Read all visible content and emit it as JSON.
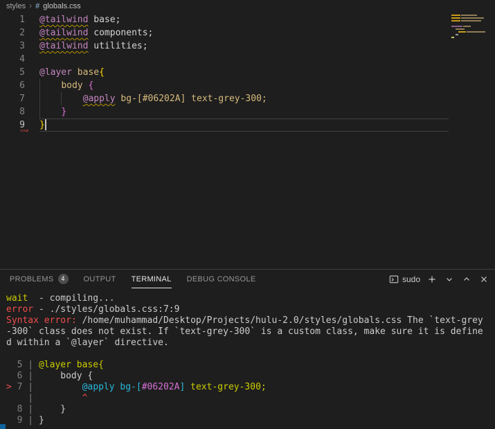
{
  "colors": {
    "background": "#1e1e1e",
    "accent_blue": "#0e639c",
    "error_red": "#f14c4c",
    "warning_yellow": "#cdcd00",
    "syntax_atrule": "#c586c0",
    "syntax_selector": "#d7ba7d",
    "syntax_plain": "#d4d4d4",
    "bracket_gold": "#ffd700",
    "bracket_purple": "#da70d6",
    "terminal_cyan": "#29b8db",
    "terminal_magenta": "#d670d6"
  },
  "breadcrumb": {
    "folder": "styles",
    "separator": "›",
    "file_symbol": "#",
    "file": "globals.css"
  },
  "editor": {
    "lines": [
      {
        "num": "1",
        "segs": [
          {
            "t": "@tailwind",
            "c": "atrule squiggle"
          },
          {
            "t": " base;",
            "c": "plain"
          }
        ]
      },
      {
        "num": "2",
        "segs": [
          {
            "t": "@tailwind",
            "c": "atrule squiggle"
          },
          {
            "t": " components;",
            "c": "plain"
          }
        ]
      },
      {
        "num": "3",
        "segs": [
          {
            "t": "@tailwind",
            "c": "atrule squiggle"
          },
          {
            "t": " utilities;",
            "c": "plain"
          }
        ]
      },
      {
        "num": "4",
        "segs": []
      },
      {
        "num": "5",
        "segs": [
          {
            "t": "@layer",
            "c": "atrule"
          },
          {
            "t": " ",
            "c": "plain"
          },
          {
            "t": "base",
            "c": "selector"
          },
          {
            "t": "{",
            "c": "brace1"
          }
        ]
      },
      {
        "num": "6",
        "segs": [
          {
            "t": "    ",
            "c": "plain"
          },
          {
            "t": "body",
            "c": "selector"
          },
          {
            "t": " ",
            "c": "plain"
          },
          {
            "t": "{",
            "c": "brace2"
          }
        ]
      },
      {
        "num": "7",
        "segs": [
          {
            "t": "        ",
            "c": "plain"
          },
          {
            "t": "@apply",
            "c": "atrule squiggle"
          },
          {
            "t": " ",
            "c": "plain"
          },
          {
            "t": "bg-[#06202A] text-grey-300;",
            "c": "selector"
          }
        ]
      },
      {
        "num": "8",
        "segs": [
          {
            "t": "    ",
            "c": "plain"
          },
          {
            "t": "}",
            "c": "brace2"
          }
        ]
      },
      {
        "num": "9",
        "segs": [
          {
            "t": "}",
            "c": "brace1"
          }
        ],
        "current": true,
        "cursor": true,
        "error_mark": true
      }
    ]
  },
  "panel": {
    "tabs": [
      {
        "label": "PROBLEMS",
        "badge": "4",
        "active": false
      },
      {
        "label": "OUTPUT",
        "active": false
      },
      {
        "label": "TERMINAL",
        "active": true
      },
      {
        "label": "DEBUG CONSOLE",
        "active": false
      }
    ],
    "terminal_profile": "sudo",
    "action_icons": [
      "terminal-icon",
      "new-terminal-icon",
      "chevron-down-icon",
      "chevron-up-icon",
      "close-icon"
    ]
  },
  "terminal": {
    "lines": [
      {
        "segs": [
          {
            "t": "wait",
            "c": "yellow"
          },
          {
            "t": "  - compiling...",
            "c": "plain"
          }
        ]
      },
      {
        "segs": [
          {
            "t": "error",
            "c": "red"
          },
          {
            "t": " - ./styles/globals.css:7:9",
            "c": "plain"
          }
        ]
      },
      {
        "segs": [
          {
            "t": "Syntax error:",
            "c": "red"
          },
          {
            "t": " /home/muhammad/Desktop/Projects/hulu-2.0/styles/globals.css The `text-grey",
            "c": "plain"
          }
        ]
      },
      {
        "segs": [
          {
            "t": "-300` class does not exist. If `text-grey-300` is a custom class, make sure it is define",
            "c": "plain"
          }
        ]
      },
      {
        "segs": [
          {
            "t": "d within a `@layer` directive.",
            "c": "plain"
          }
        ]
      },
      {
        "segs": []
      },
      {
        "segs": [
          {
            "t": "  5 | ",
            "c": "grey"
          },
          {
            "t": "@layer base{",
            "c": "yellow"
          }
        ]
      },
      {
        "segs": [
          {
            "t": "  6 | ",
            "c": "grey"
          },
          {
            "t": "    body {",
            "c": "plain"
          }
        ]
      },
      {
        "segs": [
          {
            "t": "> ",
            "c": "red"
          },
          {
            "t": "7 | ",
            "c": "grey"
          },
          {
            "t": "        ",
            "c": "plain"
          },
          {
            "t": "@apply",
            "c": "cyan"
          },
          {
            "t": " ",
            "c": "plain"
          },
          {
            "t": "bg-[",
            "c": "cyan"
          },
          {
            "t": "#06202A",
            "c": "magenta"
          },
          {
            "t": "]",
            "c": "cyan"
          },
          {
            "t": " ",
            "c": "plain"
          },
          {
            "t": "text-grey-300;",
            "c": "yellow"
          }
        ]
      },
      {
        "segs": [
          {
            "t": "    | ",
            "c": "grey"
          },
          {
            "t": "        ",
            "c": "plain"
          },
          {
            "t": "^",
            "c": "red"
          }
        ]
      },
      {
        "segs": [
          {
            "t": "  8 | ",
            "c": "grey"
          },
          {
            "t": "    }",
            "c": "plain"
          }
        ]
      },
      {
        "segs": [
          {
            "t": "  9 | ",
            "c": "grey"
          },
          {
            "t": "}",
            "c": "plain"
          }
        ]
      }
    ]
  }
}
